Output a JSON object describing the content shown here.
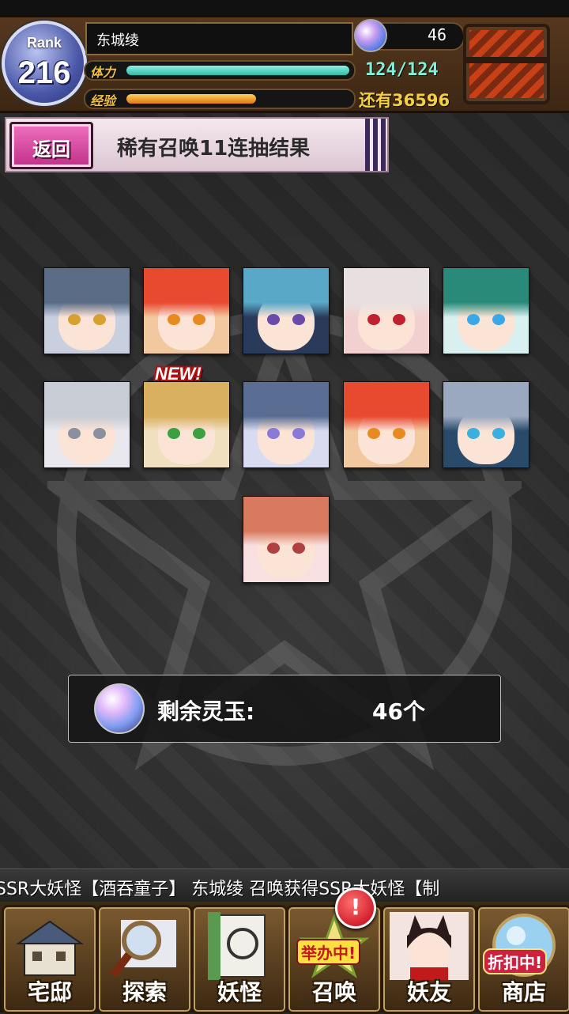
{
  "status": {
    "rank_label": "Rank",
    "rank_value": "216",
    "player_name": "东城绫",
    "stamina_label": "体力",
    "stamina_text": "124/124",
    "stamina_fraction": 1.0,
    "exp_label": "经验",
    "exp_fraction": 0.58,
    "exp_remaining_text": "还有36596",
    "jade_count": "46"
  },
  "header": {
    "back_label": "返回",
    "title": "稀有召唤11连抽结果"
  },
  "results": {
    "new_badge": "NEW!",
    "cards": [
      {
        "name": "result-card-1",
        "hair": "#5a6c86",
        "eye": "#d8a030",
        "bg": "#c8d0e0"
      },
      {
        "name": "result-card-2",
        "hair": "#e84a30",
        "eye": "#e88a20",
        "bg": "#f2c8a0"
      },
      {
        "name": "result-card-3",
        "hair": "#5aa8c8",
        "eye": "#6a4aa8",
        "bg": "#2a3a5a"
      },
      {
        "name": "result-card-4",
        "hair": "#e8e0e0",
        "eye": "#c02030",
        "bg": "#f2d0d0"
      },
      {
        "name": "result-card-5",
        "hair": "#2a8a7a",
        "eye": "#3aa8e8",
        "bg": "#d8f0f0"
      },
      {
        "name": "result-card-6",
        "hair": "#c8ccd4",
        "eye": "#8a90a0",
        "bg": "#e8e8ee"
      },
      {
        "name": "result-card-7",
        "hair": "#d8b060",
        "eye": "#3aa040",
        "bg": "#f0e0c0"
      },
      {
        "name": "result-card-8",
        "hair": "#5a6e94",
        "eye": "#8a7ad8",
        "bg": "#d8dcf0"
      },
      {
        "name": "result-card-9",
        "hair": "#e84a30",
        "eye": "#e88a20",
        "bg": "#f2c8a0"
      },
      {
        "name": "result-card-10",
        "hair": "#9aa8c0",
        "eye": "#3ab0e0",
        "bg": "#2a4a6a"
      },
      {
        "name": "result-card-11",
        "hair": "#d87a60",
        "eye": "#b04040",
        "bg": "#f8e0e0"
      }
    ]
  },
  "jade_panel": {
    "label": "剩余灵玉:",
    "value": "46个"
  },
  "ticker": {
    "text": "SSR大妖怪【酒吞童子】      东城绫 召唤获得SSR大妖怪【制"
  },
  "nav": {
    "items": [
      {
        "label": "宅邸",
        "icon": "mansion-icon"
      },
      {
        "label": "探索",
        "icon": "magnifier-icon"
      },
      {
        "label": "妖怪",
        "icon": "scroll-icon"
      },
      {
        "label": "召唤",
        "icon": "summon-icon",
        "ribbon": "举办中!"
      },
      {
        "label": "妖友",
        "icon": "friend-icon"
      },
      {
        "label": "商店",
        "icon": "shop-icon",
        "ribbon": "折扣中!"
      }
    ],
    "alert_badge": "!"
  }
}
